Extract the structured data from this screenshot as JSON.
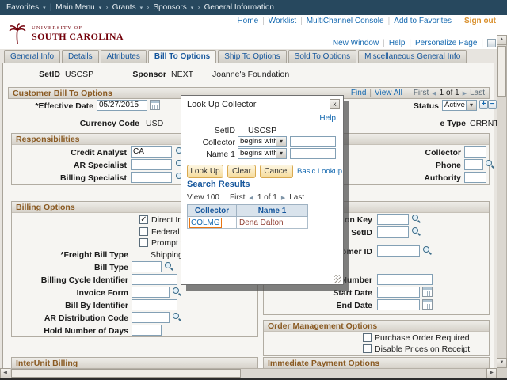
{
  "chrome": {
    "favorites": "Favorites",
    "main_menu": "Main Menu",
    "breadcrumbs": [
      "Grants",
      "Sponsors",
      "General Information"
    ],
    "utility_links": [
      "Home",
      "Worklist",
      "MultiChannel Console",
      "Add to Favorites"
    ],
    "sign_out": "Sign out",
    "logo_line1": "UNIVERSITY OF",
    "logo_line2": "SOUTH CAROLINA",
    "page_links": [
      "New Window",
      "Help",
      "Personalize Page"
    ]
  },
  "tabs": [
    "General Info",
    "Details",
    "Attributes",
    "Bill To Options",
    "Ship To Options",
    "Sold To Options",
    "Miscellaneous General Info"
  ],
  "active_tab": "Bill To Options",
  "header_fields": {
    "setid_label": "SetID",
    "setid_value": "USCSP",
    "sponsor_label": "Sponsor",
    "sponsor_value": "NEXT",
    "sponsor_name": "Joanne's Foundation"
  },
  "scroll_area": {
    "title": "Customer Bill To Options",
    "find": "Find",
    "view_all": "View All",
    "first": "First",
    "pagination": "1 of 1",
    "last": "Last"
  },
  "fields": {
    "effective_date_label": "*Effective Date",
    "effective_date_value": "05/27/2015",
    "status_label": "Status",
    "status_value": "Active",
    "currency_label": "Currency Code",
    "currency_value": "USD",
    "rate_type_label": "e Type",
    "rate_type_value": "CRRNT"
  },
  "responsibilities": {
    "title": "Responsibilities",
    "credit_analyst_label": "Credit Analyst",
    "credit_analyst_value": "CA",
    "ar_specialist_label": "AR Specialist",
    "billing_specialist_label": "Billing Specialist",
    "collector_label": "Collector",
    "phone_label": "Phone",
    "authority_label": "Authority"
  },
  "billing_options": {
    "title": "Billing Options",
    "direct_invoice_label": "Direct Invo",
    "direct_invoice_checked": true,
    "federal_label": "Federal High",
    "federal_checked": false,
    "prompt_label": "Prompt for",
    "prompt_checked": false,
    "freight_label": "*Freight Bill Type",
    "freight_value": "Shipping",
    "bill_type_label": "Bill Type",
    "billing_cycle_label": "Billing Cycle Identifier",
    "invoice_form_label": "Invoice Form",
    "bill_by_label": "Bill By Identifier",
    "ar_dist_label": "AR Distribution Code",
    "hold_days_label": "Hold Number of Days"
  },
  "right_panel": {
    "key_label": "on Key",
    "setid_label": "SetID",
    "customer_label": "omer ID",
    "number_label": "Number",
    "start_date_label": "Start Date",
    "end_date_label": "End Date"
  },
  "order_management": {
    "title": "Order Management Options",
    "po_required_label": "Purchase Order Required",
    "po_required_checked": false,
    "disable_prices_label": "Disable Prices on Receipt",
    "disable_prices_checked": false
  },
  "sections": {
    "interunit": "InterUnit Billing",
    "immediate_payment": "Immediate Payment Options"
  },
  "modal": {
    "title": "Look Up Collector",
    "help": "Help",
    "setid_label": "SetID",
    "setid_value": "USCSP",
    "collector_label": "Collector",
    "collector_operator": "begins with",
    "name1_label": "Name 1",
    "name1_operator": "begins with",
    "look_up_button": "Look Up",
    "clear_button": "Clear",
    "cancel_button": "Cancel",
    "basic_lookup_link": "Basic Lookup",
    "results_title": "Search Results",
    "view_100": "View 100",
    "first": "First",
    "pagination": "1 of 1",
    "last": "Last",
    "col1_header": "Collector",
    "col2_header": "Name 1",
    "row_collector": "COLMG",
    "row_name": "Dena Dalton"
  },
  "colors": {
    "garnet": "#73000a",
    "topbar": "#27485e",
    "link_blue": "#1569b0",
    "section_heading": "#8a5a22",
    "sign_out_orange": "#d98f2b",
    "focus_orange": "#e87511"
  }
}
